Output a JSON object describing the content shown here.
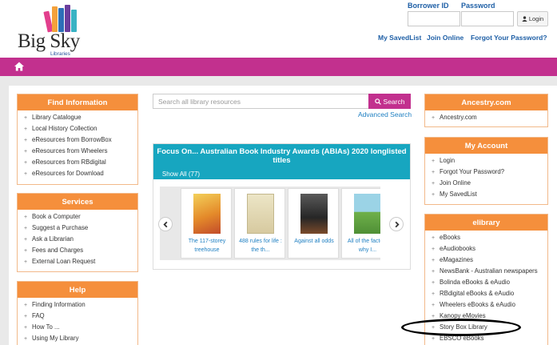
{
  "header": {
    "logo_title": "Big Sky",
    "logo_sub": "Libraries",
    "borrower_label": "Borrower ID",
    "password_label": "Password",
    "borrower_value": "",
    "password_value": "",
    "login_label": "Login",
    "links": [
      "My SavedList",
      "Join Online",
      "Forgot Your Password?"
    ]
  },
  "nav": {
    "home_icon": "home-icon"
  },
  "search": {
    "placeholder": "Search all library resources",
    "button": "Search",
    "advanced": "Advanced Search"
  },
  "find_info": {
    "title": "Find Information",
    "items": [
      "Library Catalogue",
      "Local History Collection",
      "eResources from BorrowBox",
      "eResources from Wheelers",
      "eResources from RBdigital",
      "eResources for Download"
    ]
  },
  "services": {
    "title": "Services",
    "items": [
      "Book a Computer",
      "Suggest a Purchase",
      "Ask a Librarian",
      "Fees and Charges",
      "External Loan Request"
    ]
  },
  "help": {
    "title": "Help",
    "items": [
      "Finding Information",
      "FAQ",
      "How To ...",
      "Using My Library"
    ]
  },
  "ancestry": {
    "title": "Ancestry.com",
    "items": [
      "Ancestry.com"
    ]
  },
  "account": {
    "title": "My Account",
    "items": [
      "Login",
      "Forgot Your Password?",
      "Join Online",
      "My SavedList"
    ]
  },
  "elibrary": {
    "title": "elibrary",
    "items": [
      "eBooks",
      "eAudiobooks",
      "eMagazines",
      "NewsBank - Australian newspapers",
      "Bolinda eBooks & eAudio",
      "RBdigital eBooks & eAudio",
      "Wheelers eBooks & eAudio",
      "Kanopy eMovies",
      "Story Box Library",
      "EBSCO eBooks"
    ]
  },
  "focus": {
    "title": "Focus On... Australian Book Industry Awards (ABIAs) 2020 longlisted titles",
    "show_all": "Show All (77)",
    "books": [
      {
        "caption": "The 117-storey treehouse",
        "color": "#e8b23a"
      },
      {
        "caption": "488 rules for life : the th...",
        "color": "#d8cfa8"
      },
      {
        "caption": "Against all odds",
        "color": "#3b3b3b"
      },
      {
        "caption": "All of the factors why I...",
        "color": "#7cc0d8"
      }
    ]
  },
  "colors": {
    "accent": "#f58f3c",
    "nav": "#c2308e",
    "link": "#1e5fa6",
    "focus": "#17a6c0"
  }
}
